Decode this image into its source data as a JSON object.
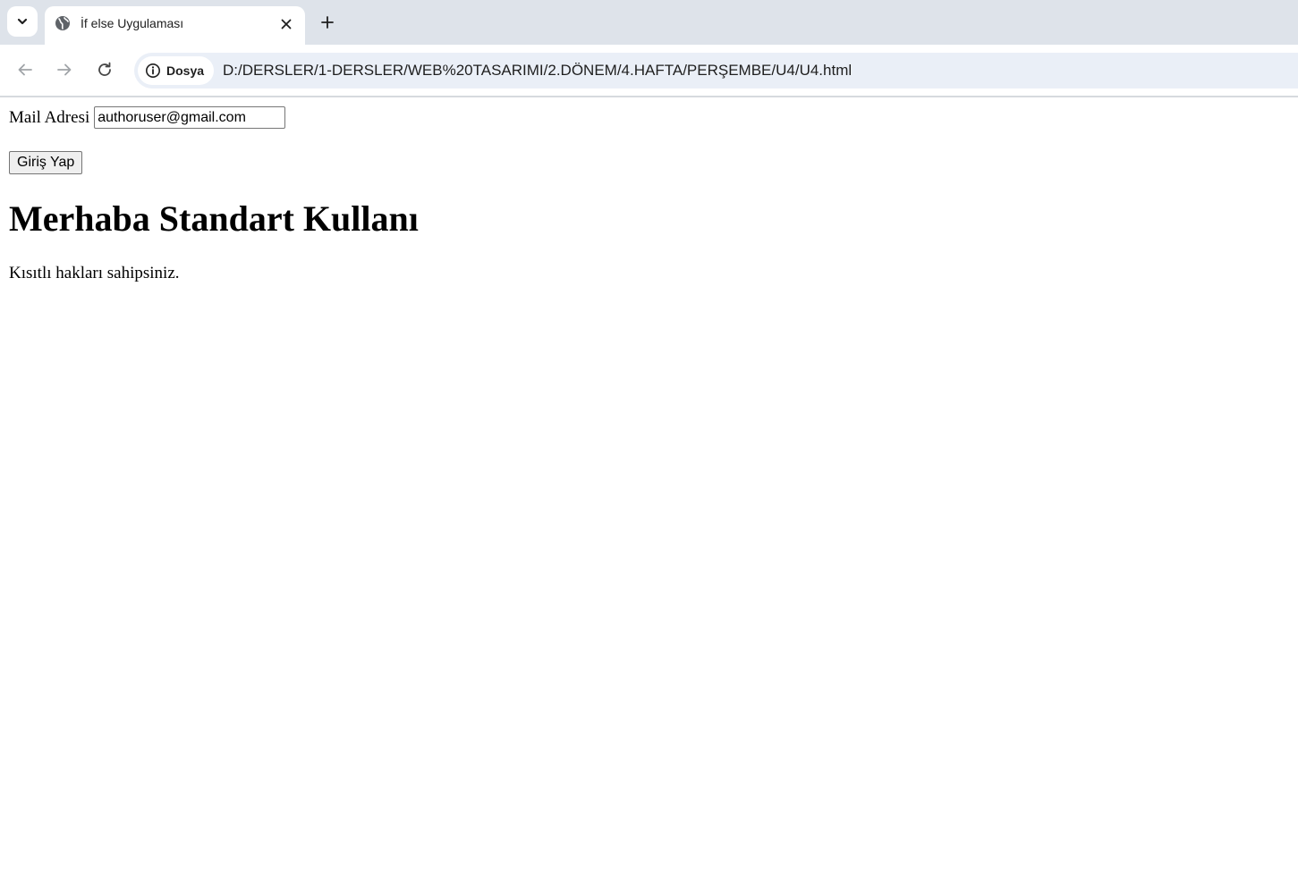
{
  "browser": {
    "tab": {
      "title": "İf else Uygulaması"
    },
    "address_bar": {
      "site_chip_label": "Dosya",
      "url": "D:/DERSLER/1-DERSLER/WEB%20TASARIMI/2.DÖNEM/4.HAFTA/PERŞEMBE/U4/U4.html"
    },
    "icons": {
      "tab_search": "chevron-down-icon",
      "favicon": "globe-icon",
      "close": "close-icon",
      "new_tab": "plus-icon",
      "back": "arrow-left-icon",
      "forward": "arrow-right-icon",
      "reload": "reload-icon",
      "site_info": "info-icon"
    },
    "colors": {
      "tabstrip": "#dee3ea",
      "omnibox": "#eaeff7"
    }
  },
  "page": {
    "mail_label": "Mail Adresi",
    "mail_value": "authoruser@gmail.com",
    "login_button": "Giriş Yap",
    "greeting": "Merhaba Standart Kullanı",
    "info": "Kısıtlı hakları sahipsiniz."
  }
}
